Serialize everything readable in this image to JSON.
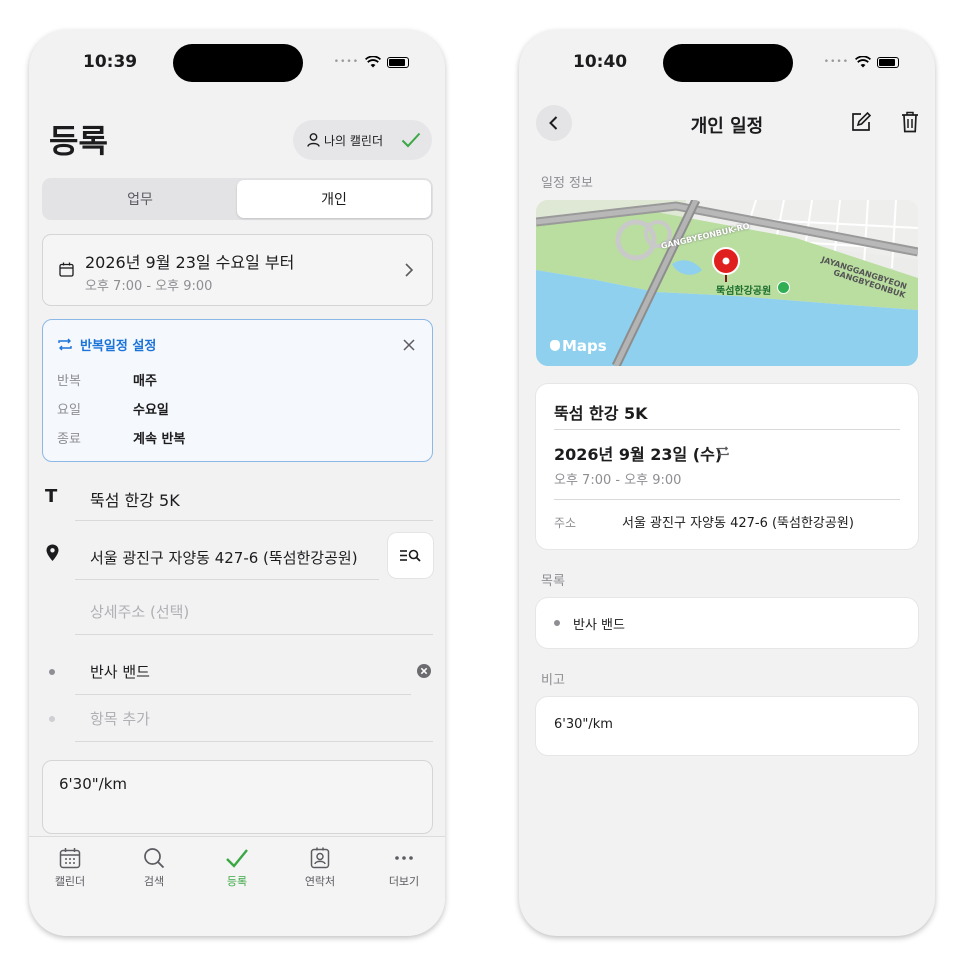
{
  "left": {
    "status_time": "10:39",
    "page_title": "등록",
    "my_calendar_label": "나의 캘린더",
    "segments": [
      "업무",
      "개인"
    ],
    "selected_segment": "개인",
    "date_line": "2026년 9월 23일 수요일 부터",
    "time_line": "오후 7:00 - 오후 9:00",
    "repeat": {
      "title": "반복일정 설정",
      "rows": [
        {
          "label": "반복",
          "value": "매주"
        },
        {
          "label": "요일",
          "value": "수요일"
        },
        {
          "label": "종료",
          "value": "계속 반복"
        }
      ]
    },
    "title_value": "뚝섬 한강 5K",
    "address_value": "서울 광진구 자양동 427-6 (뚝섬한강공원)",
    "detail_placeholder": "상세주소 (선택)",
    "item_value": "반사 밴드",
    "add_item_placeholder": "항목 추가",
    "memo_value": "6'30\"/km",
    "tabs": [
      {
        "label": "캘린더",
        "icon": "calendar-icon"
      },
      {
        "label": "검색",
        "icon": "search-icon"
      },
      {
        "label": "등록",
        "icon": "checkmark-icon"
      },
      {
        "label": "연락처",
        "icon": "contact-icon"
      },
      {
        "label": "더보기",
        "icon": "more-icon"
      }
    ],
    "active_tab": "등록",
    "accent_color": "#3aa844",
    "link_color": "#1a73d9"
  },
  "right": {
    "status_time": "10:40",
    "nav_title": "개인 일정",
    "section_info": "일정 정보",
    "map": {
      "road_label_1": "GANGBYEONBUK-RO",
      "road_label_2": "JAYANGGANGBYEON",
      "road_label_3": "GANGBYEONBUK",
      "poi_label": "뚝섬한강공원",
      "maps_logo": "Maps"
    },
    "event_title": "뚝섬 한강 5K",
    "event_date": "2026년 9월 23일 (수)",
    "event_time": "오후 7:00 - 오후 9:00",
    "address_label": "주소",
    "address_value": "서울 광진구 자양동 427-6 (뚝섬한강공원)",
    "section_list": "목록",
    "list_items": [
      "반사 밴드"
    ],
    "section_memo": "비고",
    "memo_value": "6'30\"/km"
  }
}
